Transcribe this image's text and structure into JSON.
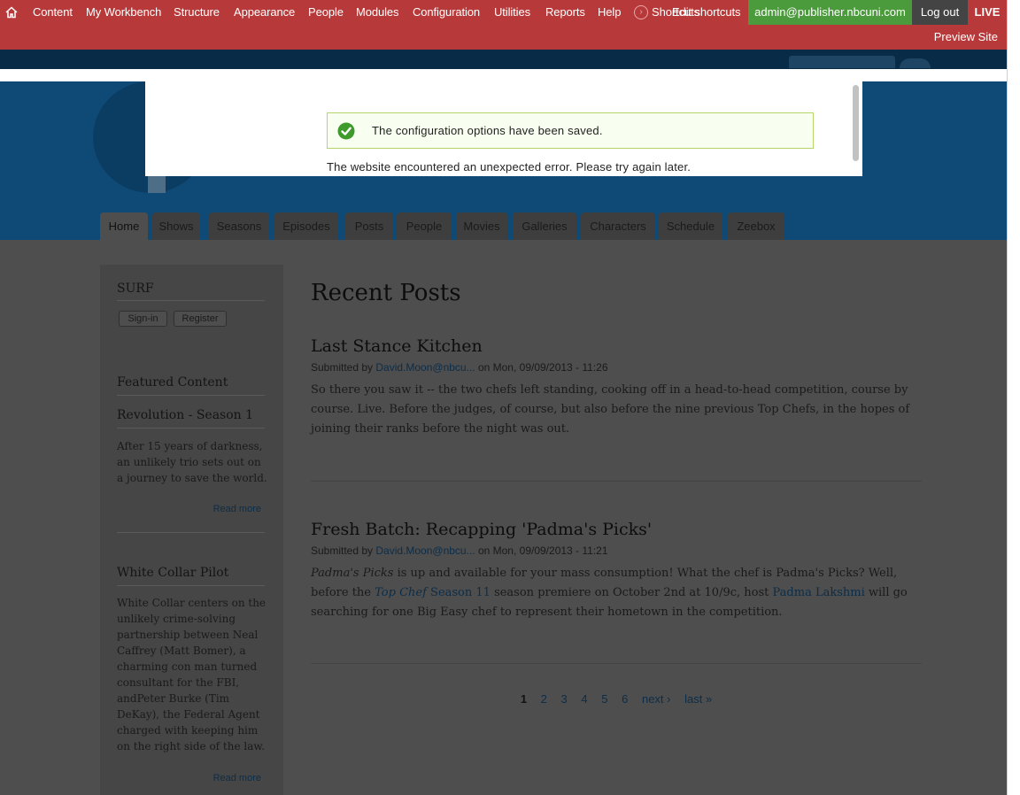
{
  "toolbar": {
    "items": [
      "Content",
      "My Workbench",
      "Structure",
      "Appearance",
      "People",
      "Modules",
      "Configuration",
      "Utilities",
      "Reports",
      "Help"
    ],
    "shortcuts_label": "Shortcuts",
    "edit_shortcuts_label": "Edit shortcuts",
    "user": "admin@publisher.nbcuni.com",
    "logout": "Log out",
    "live": "LIVE",
    "preview": "Preview Site"
  },
  "dialog": {
    "message": "The configuration options have been saved.",
    "error": "The website encountered an unexpected error. Please try again later."
  },
  "nav": {
    "tabs": [
      "Home",
      "Shows",
      "Seasons",
      "Episodes",
      "Posts",
      "People",
      "Movies",
      "Galleries",
      "Characters",
      "Schedule",
      "Zeebox"
    ]
  },
  "sidebar": {
    "surf_title": "SURF",
    "signin": "Sign-in",
    "register": "Register",
    "featured_title": "Featured Content",
    "featured": [
      {
        "title": "Revolution - Season 1",
        "text": "After 15 years of darkness, an unlikely trio sets out on a journey to save the world.",
        "read_more": "Read more"
      },
      {
        "title": "White Collar Pilot",
        "text": "White Collar centers on the unlikely crime-solving partnership between Neal Caffrey (Matt Bomer), a charming con man turned consultant for the FBI, andPeter Burke (Tim DeKay), the Federal Agent charged with keeping him on the right side of the law.",
        "read_more": "Read more"
      }
    ]
  },
  "main": {
    "heading": "Recent Posts",
    "posts": [
      {
        "title": "Last Stance Kitchen",
        "meta_prefix": "Submitted by ",
        "author": "David.Moon@nbcu...",
        "meta_suffix": " on Mon, 09/09/2013 - 11:26",
        "body": "So there you saw it -- the two chefs left standing, cooking off in a head-to-head competition, course by course. Live. Before the judges, of course, but also before the nine previous Top Chefs, in the hopes of joining their ranks before the night was out."
      },
      {
        "title": "Fresh Batch: Recapping 'Padma's Picks'",
        "meta_prefix": "Submitted by ",
        "author": "David.Moon@nbcu...",
        "meta_suffix": " on Mon, 09/09/2013 - 11:21",
        "body_parts": {
          "em1": "Padma's Picks",
          "t1": " is up and available for your mass consumption! What the chef is Padma's Picks? Well, before the ",
          "link1_em": "Top Chef",
          "link1_rest": " Season 11",
          "t2": " season premiere on October 2nd at 10/9c, host ",
          "link2": "Padma Lakshmi",
          "t3": " will go searching for one Big Easy chef to represent their hometown in the competition."
        }
      }
    ],
    "pager": [
      "1",
      "2",
      "3",
      "4",
      "5",
      "6",
      "next ›",
      "last »"
    ]
  },
  "colors": {
    "toolbar": "#b8393a",
    "user_box": "#4b9a3c",
    "header": "#0f4a77",
    "overlay_dim": "#4e4e4e",
    "message_border": "#b5d56a"
  }
}
